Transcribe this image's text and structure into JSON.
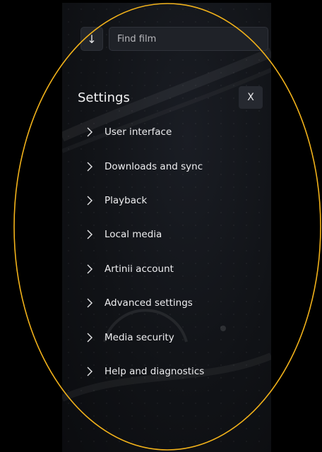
{
  "search": {
    "sort_icon": "↓",
    "placeholder": "Find film"
  },
  "settings": {
    "title": "Settings",
    "close_label": "X",
    "items": [
      {
        "label": "User interface"
      },
      {
        "label": "Downloads and sync"
      },
      {
        "label": "Playback"
      },
      {
        "label": "Local media"
      },
      {
        "label": "Artinii account"
      },
      {
        "label": "Advanced settings"
      },
      {
        "label": "Media security"
      },
      {
        "label": "Help and diagnostics"
      }
    ]
  },
  "colors": {
    "panel_bg": "#111317",
    "text": "#eeeef0",
    "highlight_oval": "#f2b21a"
  }
}
